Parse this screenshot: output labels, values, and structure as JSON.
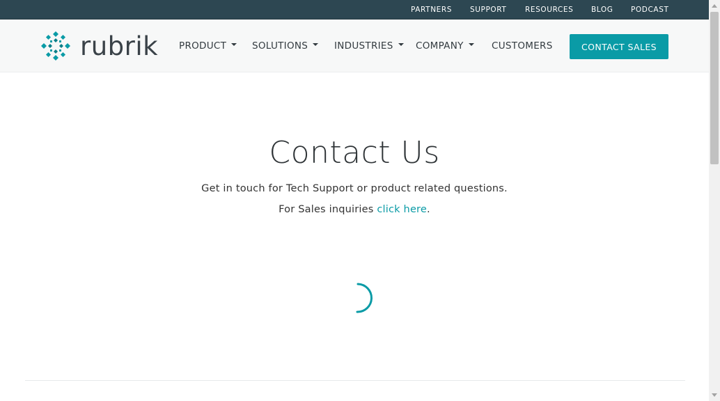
{
  "topbar": {
    "links": [
      "PARTNERS",
      "SUPPORT",
      "RESOURCES",
      "BLOG",
      "PODCAST"
    ]
  },
  "header": {
    "logo_text": "rubrik",
    "nav": [
      {
        "label": "PRODUCT",
        "dropdown": true
      },
      {
        "label": "SOLUTIONS",
        "dropdown": true
      },
      {
        "label": "INDUSTRIES",
        "dropdown": true
      },
      {
        "label": "COMPANY",
        "dropdown": true
      },
      {
        "label": "CUSTOMERS",
        "dropdown": false
      }
    ],
    "cta_label": "CONTACT SALES"
  },
  "main": {
    "title": "Contact Us",
    "subtitle": "Get in touch for Tech Support or product related questions.",
    "sales_prefix": "For Sales inquiries ",
    "sales_link": "click here",
    "sales_suffix": "."
  },
  "colors": {
    "accent": "#0a9ba6",
    "topbar": "#2d4752",
    "header_bg": "#f7f8f8",
    "text": "#333333"
  },
  "icons": [
    "rubrik-logo-icon",
    "chevron-down-icon",
    "loading-spinner-icon"
  ]
}
